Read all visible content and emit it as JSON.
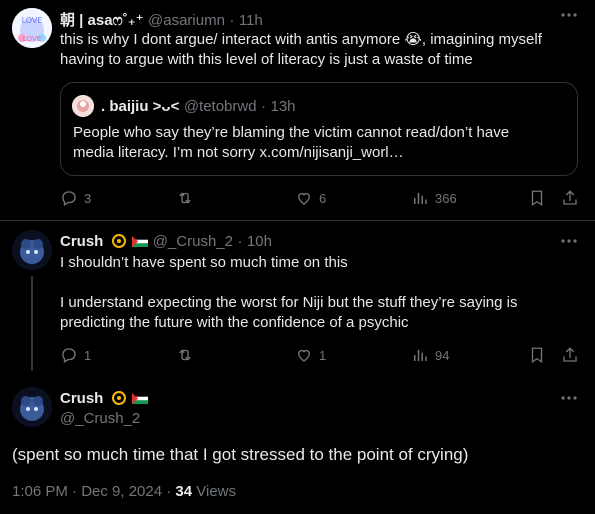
{
  "tweet1": {
    "display_name": "朝 | asaෆ˚₊⁺",
    "handle": "@asariumn",
    "sep": "·",
    "time": "11h",
    "text": "this is why I dont argue/ interact with antis anymore 😭, imagining myself having to argue with this level of literacy is just a waste of time",
    "quote": {
      "display_name": ". baijiu >ᴗ<",
      "handle": "@tetobrwd",
      "sep": "·",
      "time": "13h",
      "text": "People who say they’re blaming the victim cannot read/don’t have media literacy. I’m not sorry x.com/nijisanji_worl…"
    },
    "actions": {
      "replies": "3",
      "reposts": "",
      "likes": "6",
      "views": "366"
    }
  },
  "tweet2": {
    "display_name": "Crush",
    "handle": "@_Crush_2",
    "sep": "·",
    "time": "10h",
    "text_p1": "I shouldn’t have spent so much time on this",
    "text_p2": "I understand expecting the worst for Niji but the stuff they’re saying is predicting the future with the confidence of a psychic",
    "actions": {
      "replies": "1",
      "reposts": "",
      "likes": "1",
      "views": "94"
    }
  },
  "main_tweet": {
    "display_name": "Crush",
    "handle": "@_Crush_2",
    "text": "(spent so much time that I got stressed to the point of crying)",
    "timestamp": "1:06 PM · Dec 9, 2024 · ",
    "views_count": "34",
    "views_label": " Views"
  },
  "icons": {
    "reply": "reply-icon",
    "repost": "repost-icon",
    "like": "like-icon",
    "views": "views-icon",
    "bookmark": "bookmark-icon",
    "share": "share-icon",
    "more": "more-icon"
  },
  "colors": {
    "background": "#000000",
    "text": "#e7e9ea",
    "secondary_text": "#71767b",
    "border": "#2f3336"
  }
}
